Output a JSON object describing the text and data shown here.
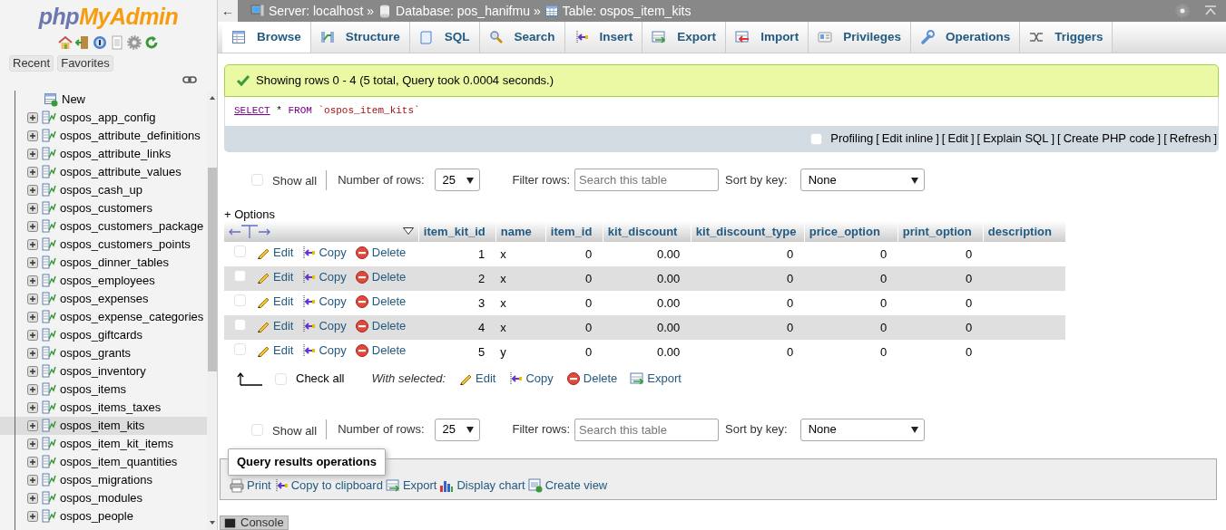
{
  "logo": [
    "php",
    "MyAdmin"
  ],
  "sidebar": {
    "buttons": [
      "Recent",
      "Favorites"
    ],
    "tree": [
      {
        "label": "New",
        "kind": "new",
        "selected": false
      },
      {
        "label": "ospos_app_config",
        "kind": "table",
        "selected": false
      },
      {
        "label": "ospos_attribute_definitions",
        "kind": "table",
        "selected": false
      },
      {
        "label": "ospos_attribute_links",
        "kind": "table",
        "selected": false
      },
      {
        "label": "ospos_attribute_values",
        "kind": "table",
        "selected": false
      },
      {
        "label": "ospos_cash_up",
        "kind": "table",
        "selected": false
      },
      {
        "label": "ospos_customers",
        "kind": "table",
        "selected": false
      },
      {
        "label": "ospos_customers_package",
        "kind": "table",
        "selected": false
      },
      {
        "label": "ospos_customers_points",
        "kind": "table",
        "selected": false
      },
      {
        "label": "ospos_dinner_tables",
        "kind": "table",
        "selected": false
      },
      {
        "label": "ospos_employees",
        "kind": "table",
        "selected": false
      },
      {
        "label": "ospos_expenses",
        "kind": "table",
        "selected": false
      },
      {
        "label": "ospos_expense_categories",
        "kind": "table",
        "selected": false
      },
      {
        "label": "ospos_giftcards",
        "kind": "table",
        "selected": false
      },
      {
        "label": "ospos_grants",
        "kind": "table",
        "selected": false
      },
      {
        "label": "ospos_inventory",
        "kind": "table",
        "selected": false
      },
      {
        "label": "ospos_items",
        "kind": "table",
        "selected": false
      },
      {
        "label": "ospos_items_taxes",
        "kind": "table",
        "selected": false
      },
      {
        "label": "ospos_item_kits",
        "kind": "table",
        "selected": true
      },
      {
        "label": "ospos_item_kit_items",
        "kind": "table",
        "selected": false
      },
      {
        "label": "ospos_item_quantities",
        "kind": "table",
        "selected": false
      },
      {
        "label": "ospos_migrations",
        "kind": "table",
        "selected": false
      },
      {
        "label": "ospos_modules",
        "kind": "table",
        "selected": false
      },
      {
        "label": "ospos_people",
        "kind": "table",
        "selected": false
      }
    ]
  },
  "back": "←",
  "breadcrumb": {
    "separator": "»",
    "items": [
      {
        "label": "Server: localhost",
        "kind": "server"
      },
      {
        "label": "Database: pos_hanifmu",
        "kind": "database"
      },
      {
        "label": "Table: ospos_item_kits",
        "kind": "table"
      }
    ]
  },
  "tabs": [
    {
      "label": "Browse",
      "kind": "browse",
      "selected": true
    },
    {
      "label": "Structure",
      "kind": "structure",
      "selected": false
    },
    {
      "label": "SQL",
      "kind": "sql",
      "selected": false
    },
    {
      "label": "Search",
      "kind": "search",
      "selected": false
    },
    {
      "label": "Insert",
      "kind": "insert",
      "selected": false
    },
    {
      "label": "Export",
      "kind": "export",
      "selected": false
    },
    {
      "label": "Import",
      "kind": "import",
      "selected": false
    },
    {
      "label": "Privileges",
      "kind": "privileges",
      "selected": false
    },
    {
      "label": "Operations",
      "kind": "operations",
      "selected": false
    },
    {
      "label": "Triggers",
      "kind": "triggers",
      "selected": false
    }
  ],
  "message": "Showing rows 0 - 4 (5 total, Query took 0.0004 seconds.)",
  "sql": [
    {
      "text": "SELECT",
      "kind": "keyword"
    },
    {
      "text": "*",
      "kind": "operator"
    },
    {
      "text": "FROM",
      "kind": "keyword"
    },
    {
      "text": "`ospos_item_kits`",
      "kind": "identifier"
    }
  ],
  "profiling": {
    "label": "Profiling",
    "checked": false,
    "open": "[",
    "close": "]",
    "links": [
      "Edit inline",
      "Edit",
      "Explain SQL",
      "Create PHP code",
      "Refresh"
    ]
  },
  "nav_top": {
    "show_all": "Show all",
    "checked": false,
    "rows_label": "Number of rows:",
    "rows_value": "25",
    "filter_label": "Filter rows:",
    "filter_placeholder": "Search this table",
    "sort_label": "Sort by key:",
    "sort_value": "None"
  },
  "options": "+ Options",
  "table": {
    "columns": [
      {
        "label": "item_kit_id",
        "kind": "number"
      },
      {
        "label": "name",
        "kind": "text"
      },
      {
        "label": "item_id",
        "kind": "number"
      },
      {
        "label": "kit_discount",
        "kind": "number"
      },
      {
        "label": "kit_discount_type",
        "kind": "number"
      },
      {
        "label": "price_option",
        "kind": "number"
      },
      {
        "label": "print_option",
        "kind": "number"
      },
      {
        "label": "description",
        "kind": "text"
      }
    ],
    "rows": [
      {
        "checked": false,
        "actions": [
          {
            "label": "Edit",
            "kind": "edit"
          },
          {
            "label": "Copy",
            "kind": "copy"
          },
          {
            "label": "Delete",
            "kind": "delete"
          }
        ],
        "cells": [
          "1",
          "x",
          "0",
          "0.00",
          "0",
          "0",
          "0"
        ]
      },
      {
        "checked": false,
        "actions": [
          {
            "label": "Edit",
            "kind": "edit"
          },
          {
            "label": "Copy",
            "kind": "copy"
          },
          {
            "label": "Delete",
            "kind": "delete"
          }
        ],
        "cells": [
          "2",
          "x",
          "0",
          "0.00",
          "0",
          "0",
          "0"
        ]
      },
      {
        "checked": false,
        "actions": [
          {
            "label": "Edit",
            "kind": "edit"
          },
          {
            "label": "Copy",
            "kind": "copy"
          },
          {
            "label": "Delete",
            "kind": "delete"
          }
        ],
        "cells": [
          "3",
          "x",
          "0",
          "0.00",
          "0",
          "0",
          "0"
        ]
      },
      {
        "checked": false,
        "actions": [
          {
            "label": "Edit",
            "kind": "edit"
          },
          {
            "label": "Copy",
            "kind": "copy"
          },
          {
            "label": "Delete",
            "kind": "delete"
          }
        ],
        "cells": [
          "4",
          "x",
          "0",
          "0.00",
          "0",
          "0",
          "0"
        ]
      },
      {
        "checked": false,
        "actions": [
          {
            "label": "Edit",
            "kind": "edit"
          },
          {
            "label": "Copy",
            "kind": "copy"
          },
          {
            "label": "Delete",
            "kind": "delete"
          }
        ],
        "cells": [
          "5",
          "y",
          "0",
          "0.00",
          "0",
          "0",
          "0"
        ]
      }
    ]
  },
  "bulk": {
    "check_all": "Check all",
    "checked": false,
    "with_selected": "With selected:",
    "actions": [
      {
        "label": "Edit",
        "kind": "edit"
      },
      {
        "label": "Copy",
        "kind": "copy"
      },
      {
        "label": "Delete",
        "kind": "delete"
      },
      {
        "label": "Export",
        "kind": "export"
      }
    ]
  },
  "nav_bottom": {
    "show_all": "Show all",
    "checked": false,
    "rows_label": "Number of rows:",
    "rows_value": "25",
    "filter_label": "Filter rows:",
    "filter_placeholder": "Search this table",
    "sort_label": "Sort by key:",
    "sort_value": "None"
  },
  "query_ops": {
    "title": "Query results operations",
    "actions": [
      {
        "label": "Print",
        "kind": "print"
      },
      {
        "label": "Copy to clipboard",
        "kind": "copy"
      },
      {
        "label": "Export",
        "kind": "export"
      },
      {
        "label": "Display chart",
        "kind": "chart"
      },
      {
        "label": "Create view",
        "kind": "view"
      }
    ]
  },
  "console": "Console"
}
